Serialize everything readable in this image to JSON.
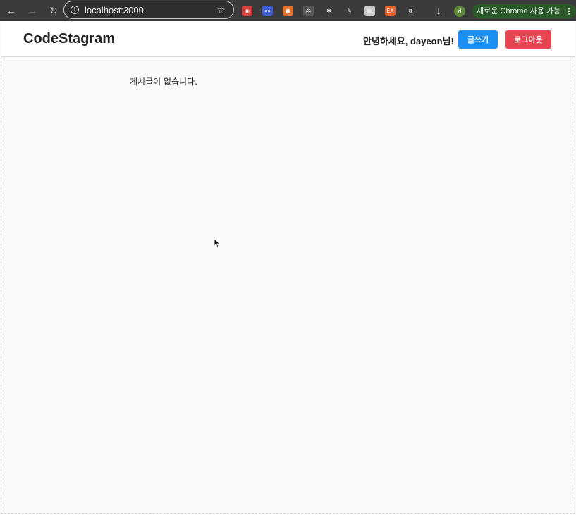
{
  "browser": {
    "url": "localhost:3000",
    "profile_initial": "d",
    "update_label": "새로운 Chrome 사용 가능",
    "extensions": [
      {
        "icon": "red-ext-icon",
        "color": "#d6403a",
        "glyph": "◉"
      },
      {
        "icon": "blue-ext-icon",
        "color": "#3b5bd6",
        "glyph": "«»"
      },
      {
        "icon": "color-ext-icon",
        "color": "#e0702a",
        "glyph": "●"
      },
      {
        "icon": "target-ext-icon",
        "color": "#5a5a5a",
        "glyph": "◎"
      },
      {
        "icon": "bug-ext-icon",
        "color": "#3b3b3b",
        "glyph": "✱"
      },
      {
        "icon": "eyedropper-ext-icon",
        "color": "#3b3b3b",
        "glyph": "✎"
      },
      {
        "icon": "doc-ext-icon",
        "color": "#c9c9c9",
        "glyph": "▤"
      },
      {
        "icon": "orange-ext-icon",
        "color": "#e8632a",
        "glyph": "EX"
      },
      {
        "icon": "puzzle-icon",
        "color": "#3b3b3b",
        "glyph": "⧉"
      }
    ]
  },
  "header": {
    "brand": "CodeStagram",
    "greeting": "안녕하세요, dayeon님!",
    "write_label": "글쓰기",
    "logout_label": "로그아웃"
  },
  "main": {
    "empty_message": "게시글이 없습니다."
  },
  "colors": {
    "write_button": "#1d8ff0",
    "logout_button": "#e84552"
  }
}
